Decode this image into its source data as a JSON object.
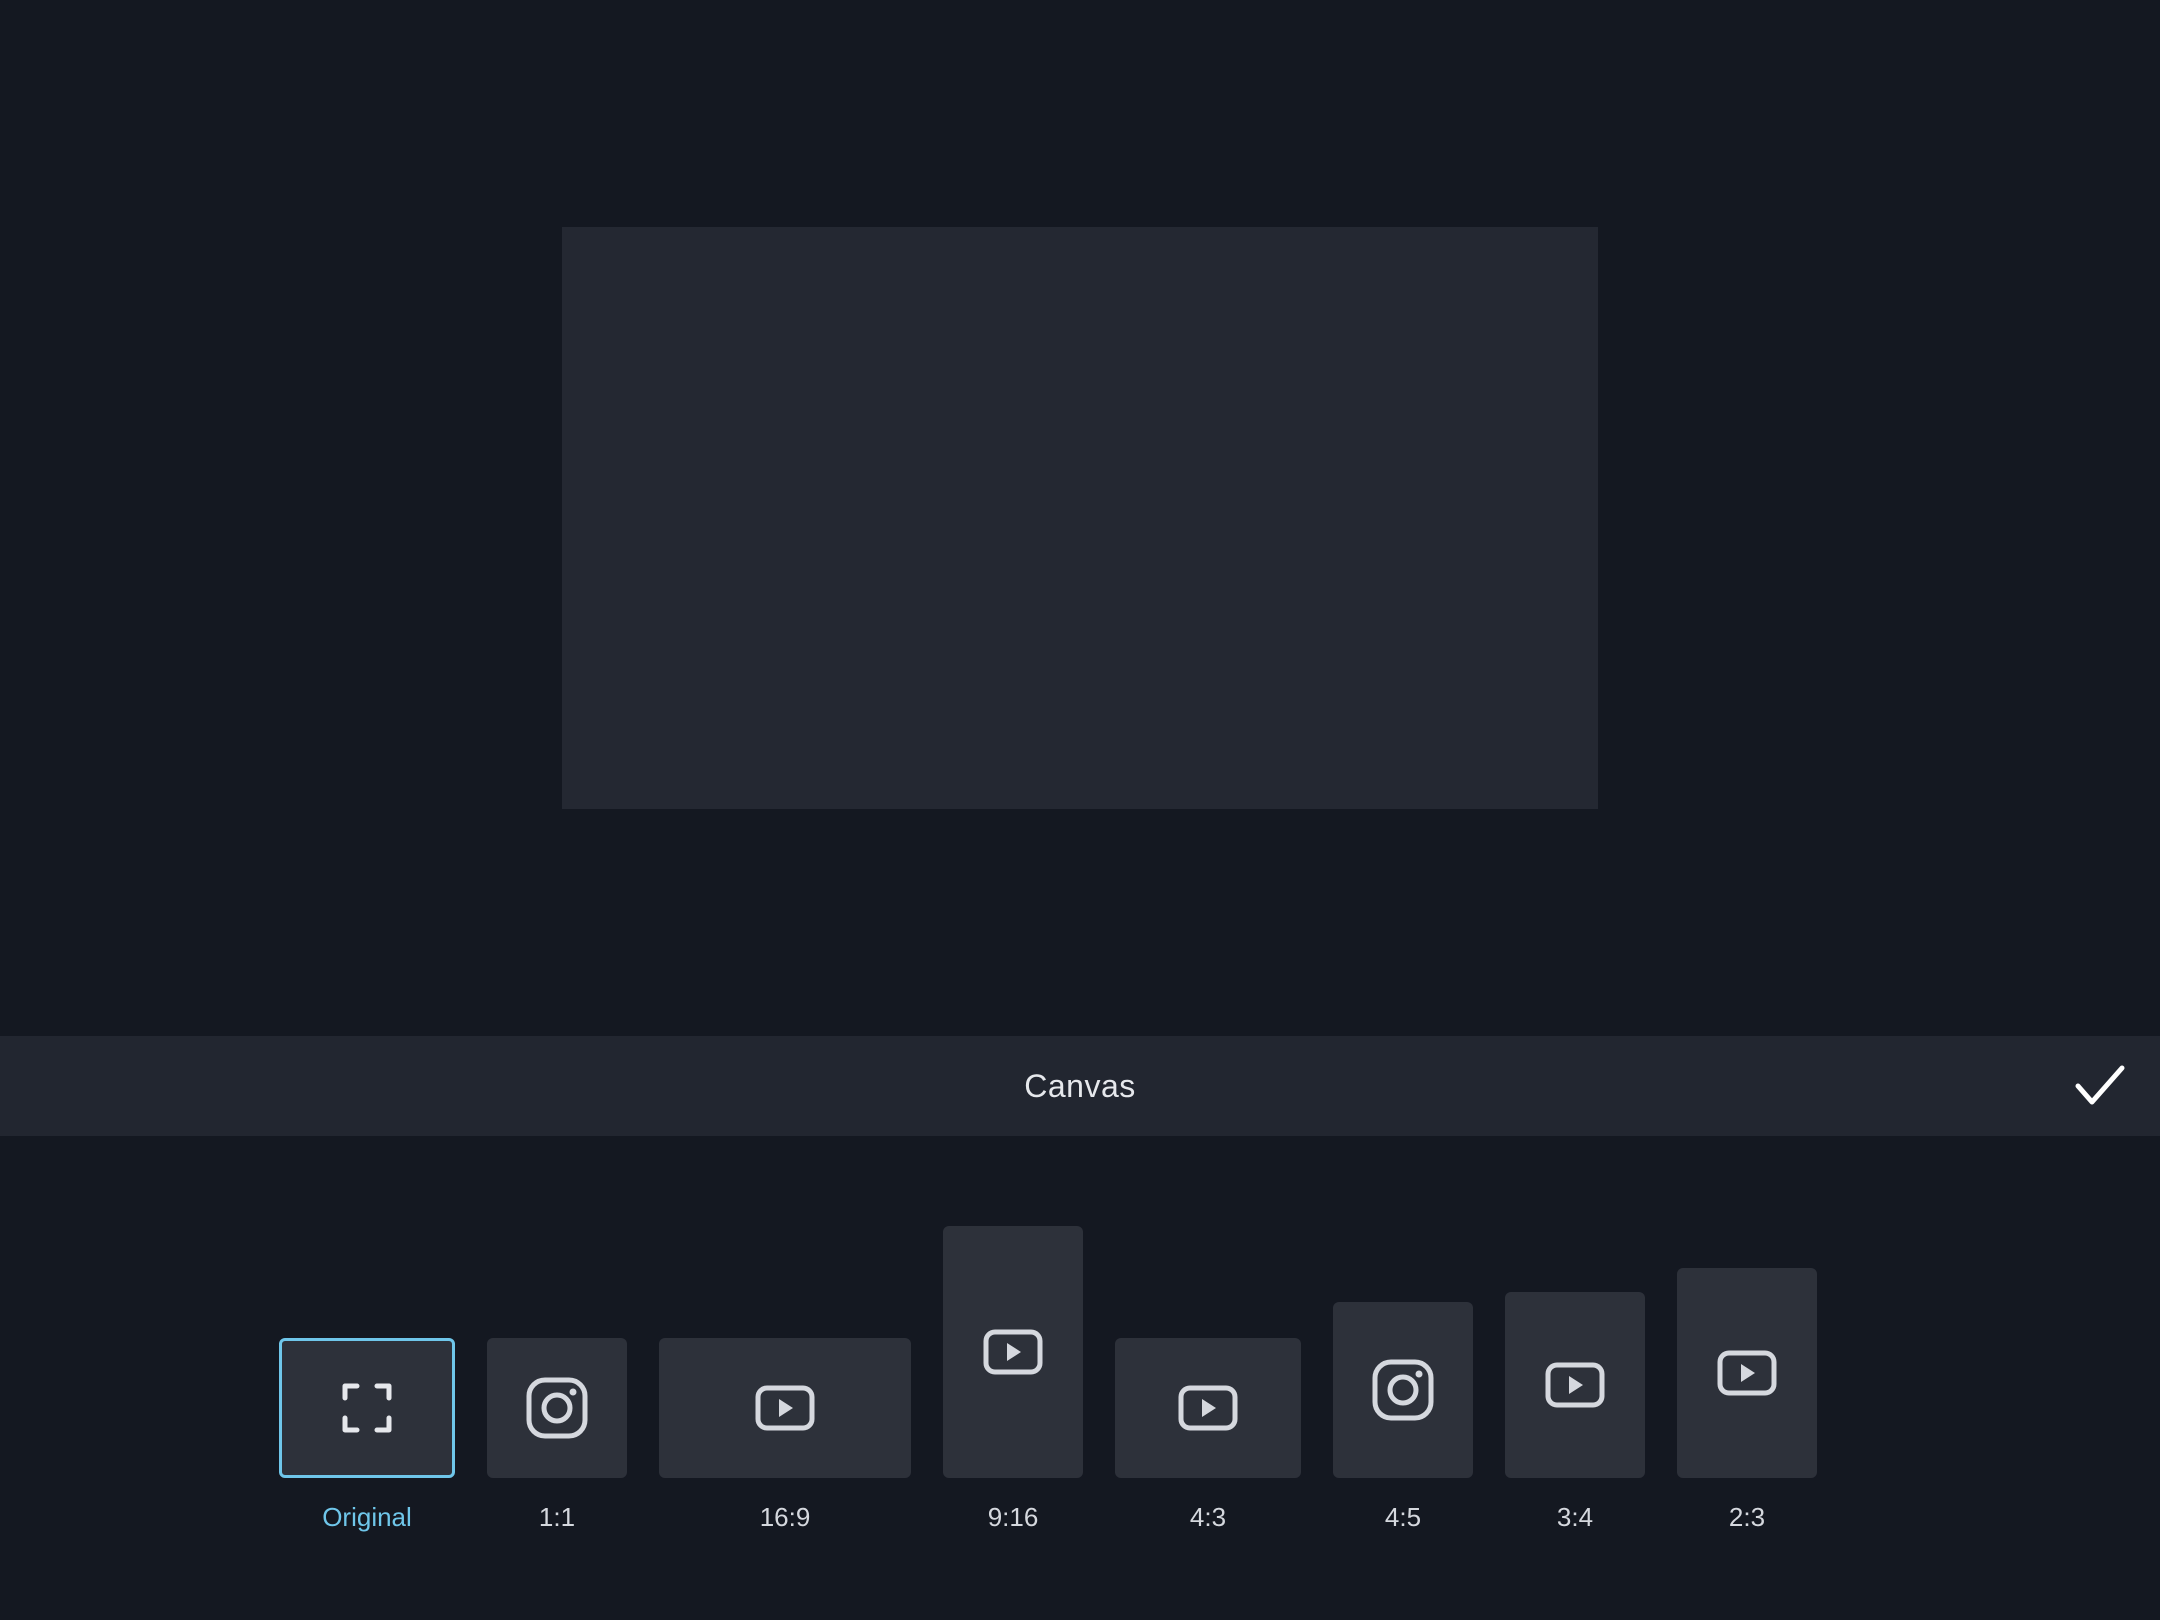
{
  "toolbar": {
    "title": "Canvas",
    "confirm_icon": "checkmark-icon"
  },
  "ratios": [
    {
      "label": "Original",
      "icon": "fullscreen-corners-icon",
      "selected": true
    },
    {
      "label": "1:1",
      "icon": "instagram-icon",
      "selected": false
    },
    {
      "label": "16:9",
      "icon": "youtube-icon",
      "selected": false
    },
    {
      "label": "9:16",
      "icon": "youtube-icon",
      "selected": false
    },
    {
      "label": "4:3",
      "icon": "youtube-icon",
      "selected": false
    },
    {
      "label": "4:5",
      "icon": "instagram-icon",
      "selected": false
    },
    {
      "label": "3:4",
      "icon": "youtube-icon",
      "selected": false
    },
    {
      "label": "2:3",
      "icon": "youtube-icon",
      "selected": false
    }
  ],
  "colors": {
    "background": "#141821",
    "panel": "#222630",
    "tile": "#2d313a",
    "accent": "#6fc6ea",
    "text": "#e6e8ec"
  }
}
